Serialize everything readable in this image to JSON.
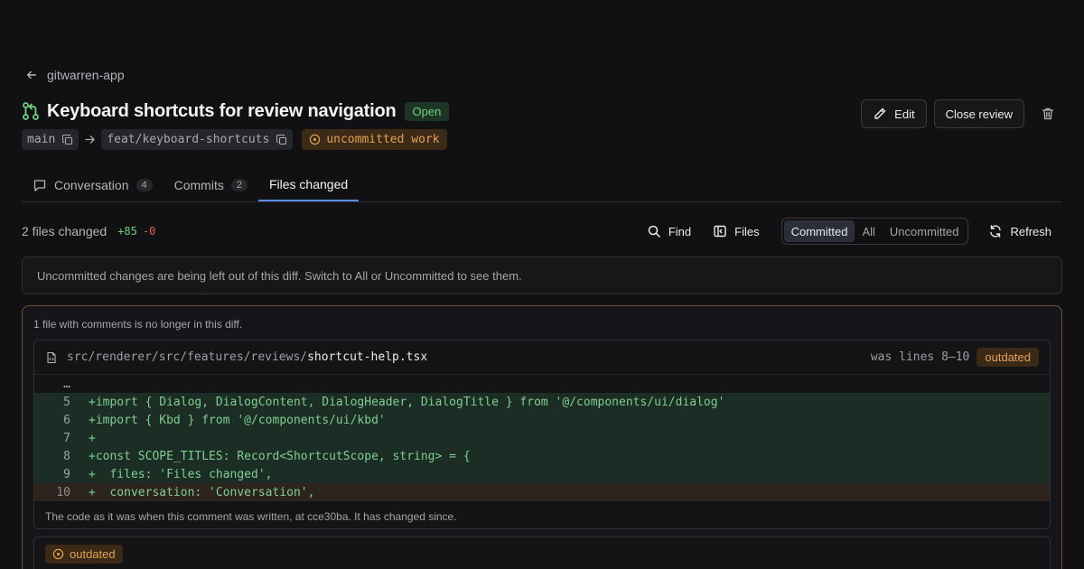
{
  "header": {
    "back_label": "gitwarren-app",
    "title": "Keyboard shortcuts for review navigation",
    "status": "Open",
    "base_branch": "main",
    "head_branch": "feat/keyboard-shortcuts",
    "uncommitted_badge": "uncommitted work",
    "edit_label": "Edit",
    "close_label": "Close review"
  },
  "tabs": [
    {
      "label": "Conversation",
      "count": "4"
    },
    {
      "label": "Commits",
      "count": "2"
    },
    {
      "label": "Files changed"
    }
  ],
  "toolbar": {
    "files_changed": "2 files changed",
    "additions": "+85",
    "deletions": "-0",
    "find_label": "Find",
    "files_label": "Files",
    "segments": [
      "Committed",
      "All",
      "Uncommitted"
    ],
    "selected_segment": "Committed",
    "refresh_label": "Refresh"
  },
  "notice": "Uncommitted changes are being left out of this diff. Switch to All or Uncommitted to see them.",
  "outdated": {
    "note": "1 file with comments is no longer in this diff.",
    "path_dir": "src/renderer/src/features/reviews/",
    "path_file": "shortcut-help.tsx",
    "was_lines": "was lines 8–10",
    "badge": "outdated",
    "ellipsis": "…",
    "lines": [
      {
        "n": "5",
        "text": "+import { Dialog, DialogContent, DialogHeader, DialogTitle } from '@/components/ui/dialog'"
      },
      {
        "n": "6",
        "text": "+import { Kbd } from '@/components/ui/kbd'"
      },
      {
        "n": "7",
        "text": "+"
      },
      {
        "n": "8",
        "text": "+const SCOPE_TITLES: Record<ShortcutScope, string> = {"
      },
      {
        "n": "9",
        "text": "+  files: 'Files changed',"
      },
      {
        "n": "10",
        "text": "+  conversation: 'Conversation',"
      }
    ],
    "footer": "The code as it was when this comment was written, at cce30ba. It has changed since.",
    "comment_badge": "outdated"
  },
  "colors": {
    "accent": "#5b8de8",
    "added": "#6fcf7f",
    "removed": "#e06060",
    "warning": "#e2a054"
  }
}
